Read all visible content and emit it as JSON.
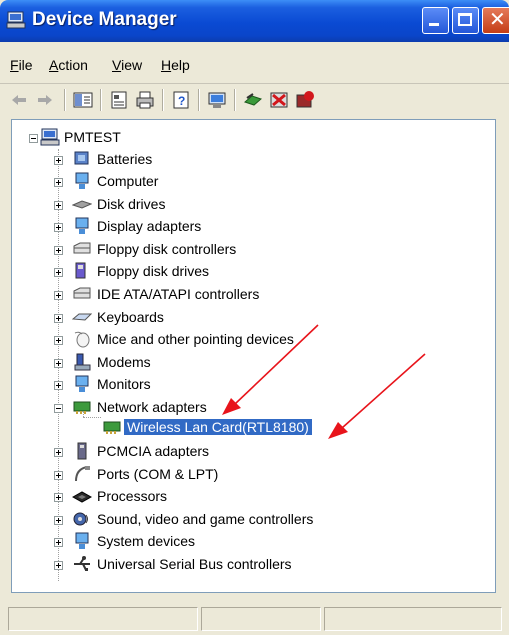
{
  "window": {
    "title": "Device Manager"
  },
  "menu": [
    {
      "label": "File",
      "mnemonic": "F",
      "rest": "ile"
    },
    {
      "label": "Action",
      "mnemonic": "A",
      "rest": "ction"
    },
    {
      "label": "View",
      "mnemonic": "V",
      "rest": "iew"
    },
    {
      "label": "Help",
      "mnemonic": "H",
      "rest": "elp"
    }
  ],
  "tree": {
    "root": "PMTEST",
    "categories": [
      {
        "label": "Batteries",
        "icon": "battery-icon"
      },
      {
        "label": "Computer",
        "icon": "computer-icon"
      },
      {
        "label": "Disk drives",
        "icon": "disk-drive-icon"
      },
      {
        "label": "Display adapters",
        "icon": "display-adapter-icon"
      },
      {
        "label": "Floppy disk controllers",
        "icon": "floppy-controller-icon"
      },
      {
        "label": "Floppy disk drives",
        "icon": "floppy-drive-icon"
      },
      {
        "label": "IDE ATA/ATAPI controllers",
        "icon": "ide-controller-icon"
      },
      {
        "label": "Keyboards",
        "icon": "keyboard-icon"
      },
      {
        "label": "Mice and other pointing devices",
        "icon": "mouse-icon"
      },
      {
        "label": "Modems",
        "icon": "modem-icon"
      },
      {
        "label": "Monitors",
        "icon": "monitor-icon"
      },
      {
        "label": "Network adapters",
        "icon": "network-adapter-icon"
      },
      {
        "label": "PCMCIA adapters",
        "icon": "pcmcia-icon"
      },
      {
        "label": "Ports (COM & LPT)",
        "icon": "port-icon"
      },
      {
        "label": "Processors",
        "icon": "processor-icon"
      },
      {
        "label": "Sound, video and game controllers",
        "icon": "sound-icon"
      },
      {
        "label": "System devices",
        "icon": "system-device-icon"
      },
      {
        "label": "Universal Serial Bus controllers",
        "icon": "usb-icon"
      }
    ],
    "network_child": "Wireless Lan Card(RTL8180)"
  },
  "colors": {
    "selection": "#316ac5",
    "arrow": "#e8141b",
    "titlebar": "#0a4ad3"
  }
}
